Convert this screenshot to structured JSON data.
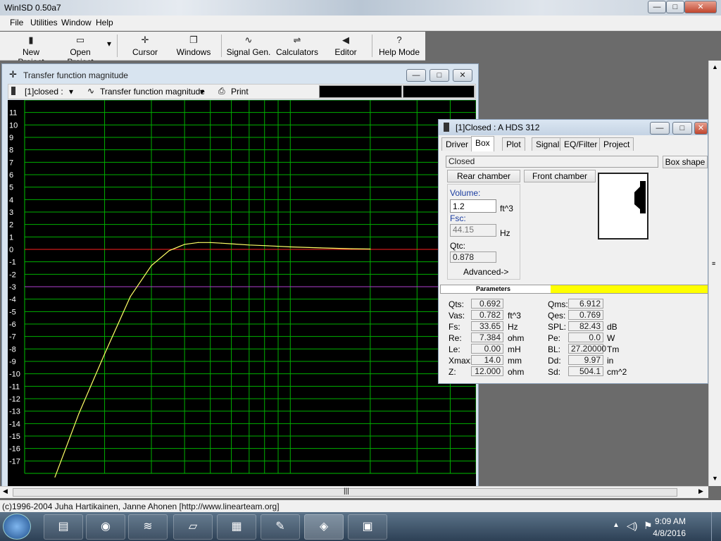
{
  "window": {
    "title": "WinISD 0.50a7",
    "min": "—",
    "max": "□",
    "close": "✕"
  },
  "menu": [
    "File",
    "Utilities",
    "Window",
    "Help"
  ],
  "toolbar": [
    {
      "label": "New Project",
      "icon": "new-project-icon",
      "glyph": "▮"
    },
    {
      "label": "Open Project",
      "icon": "open-project-icon",
      "glyph": "▭"
    },
    {
      "label": "Cursor",
      "icon": "cursor-icon",
      "glyph": "✛"
    },
    {
      "label": "Windows",
      "icon": "windows-icon",
      "glyph": "❐"
    },
    {
      "label": "Signal Gen.",
      "icon": "signal-gen-icon",
      "glyph": "∿"
    },
    {
      "label": "Calculators",
      "icon": "calculators-icon",
      "glyph": "⇌"
    },
    {
      "label": "Editor",
      "icon": "editor-icon",
      "glyph": "◀"
    },
    {
      "label": "Help Mode",
      "icon": "help-mode-icon",
      "glyph": "?"
    }
  ],
  "tf_window": {
    "title": "Transfer function magnitude",
    "project_select": "[1]closed :",
    "graph_select": "Transfer function magnitude",
    "print": "Print"
  },
  "chart_data": {
    "type": "line",
    "ylim": [
      -18,
      12
    ],
    "y_ticks": [
      "11",
      "10",
      "9",
      "8",
      "7",
      "6",
      "5",
      "4",
      "3",
      "2",
      "1",
      "0",
      "-1",
      "-2",
      "-3",
      "-4",
      "-5",
      "-6",
      "-7",
      "-8",
      "-9",
      "-10",
      "-11",
      "-12",
      "-13",
      "-14",
      "-15",
      "-16",
      "-17"
    ],
    "x_scale": "log",
    "xlim": [
      10,
      500
    ],
    "reference_lines": [
      {
        "y": 0,
        "color": "#ff2020"
      },
      {
        "y": -3,
        "color": "#b040d0"
      }
    ],
    "series": [
      {
        "color": "#ffff66",
        "x": [
          13,
          16,
          20,
          25,
          30,
          35,
          40,
          45,
          50,
          55,
          60,
          70,
          80,
          100,
          130,
          170,
          200
        ],
        "y": [
          -18.3,
          -13.2,
          -8.4,
          -3.8,
          -1.3,
          -0.1,
          0.4,
          0.55,
          0.55,
          0.5,
          0.45,
          0.35,
          0.3,
          0.2,
          0.12,
          0.05,
          0.03
        ]
      }
    ],
    "grid": true,
    "grid_color": "#00b000",
    "axis_color": "#00c000"
  },
  "box_window": {
    "title": "[1]Closed : A HDS 312",
    "tabs": [
      "Driver",
      "Box",
      "Plot",
      "Signal",
      "EQ/Filter",
      "Project"
    ],
    "active_tab": "Box",
    "box_type": "Closed",
    "box_shape_button": "Box shape",
    "rear_chamber": "Rear chamber",
    "front_chamber": "Front chamber",
    "volume_label": "Volume:",
    "volume_value": "1.2",
    "volume_unit": "ft^3",
    "fsc_label": "Fsc:",
    "fsc_value": "44.15",
    "fsc_unit": "Hz",
    "qtc_label": "Qtc:",
    "qtc_value": "0.878",
    "advanced": "Advanced->",
    "parameters_header": "Parameters",
    "params_left": [
      {
        "name": "Qts:",
        "value": "0.692",
        "unit": ""
      },
      {
        "name": "Vas:",
        "value": "0.782",
        "unit": "ft^3"
      },
      {
        "name": "Fs:",
        "value": "33.65",
        "unit": "Hz"
      },
      {
        "name": "Re:",
        "value": "7.384",
        "unit": "ohm"
      },
      {
        "name": "Le:",
        "value": "0.00",
        "unit": "mH"
      },
      {
        "name": "Xmax:",
        "value": "14.0",
        "unit": "mm"
      },
      {
        "name": "Z:",
        "value": "12.000",
        "unit": "ohm"
      }
    ],
    "params_right": [
      {
        "name": "Qms:",
        "value": "6.912",
        "unit": ""
      },
      {
        "name": "Qes:",
        "value": "0.769",
        "unit": ""
      },
      {
        "name": "SPL:",
        "value": "82.43",
        "unit": "dB"
      },
      {
        "name": "Pe:",
        "value": "0.0",
        "unit": "W"
      },
      {
        "name": "BL:",
        "value": "27.20000",
        "unit": "Tm"
      },
      {
        "name": "Dd:",
        "value": "9.97",
        "unit": "in"
      },
      {
        "name": "Sd:",
        "value": "504.1",
        "unit": "cm^2"
      }
    ]
  },
  "status": "(c)1996-2004 Juha Hartikainen, Janne Ahonen [http://www.linearteam.org]",
  "taskbar": {
    "time": "9:09 AM",
    "date": "4/8/2016"
  }
}
